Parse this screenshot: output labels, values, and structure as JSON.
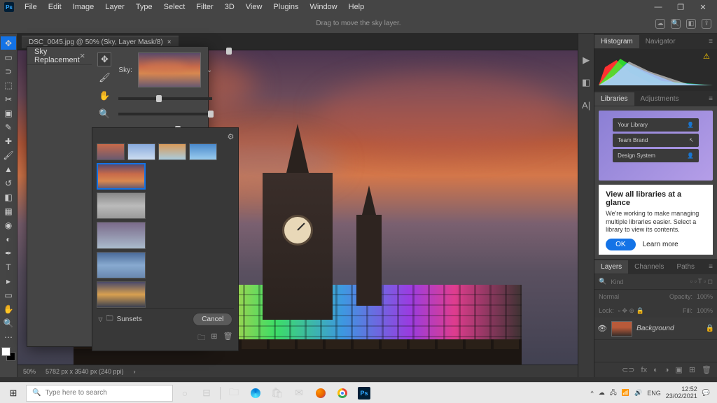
{
  "menubar": {
    "items": [
      "File",
      "Edit",
      "Image",
      "Layer",
      "Type",
      "Select",
      "Filter",
      "3D",
      "View",
      "Plugins",
      "Window",
      "Help"
    ]
  },
  "options_hint": "Drag to move the sky layer.",
  "doc_tab": "DSC_0045.jpg @ 50% (Sky, Layer Mask/8)",
  "status": {
    "zoom": "50%",
    "dims": "5782 px x 3540 px (240 ppi)"
  },
  "dialog": {
    "title": "Sky Replacement",
    "sky_label": "Sky:",
    "preset_group": "Sunsets",
    "cancel": "Cancel"
  },
  "panels": {
    "histo_tabs": [
      "Histogram",
      "Navigator"
    ],
    "lib_tabs": [
      "Libraries",
      "Adjustments"
    ],
    "lib_cards": [
      "Your Library",
      "Team Brand",
      "Design System"
    ],
    "lib_heading": "View all libraries at a glance",
    "lib_body": "We're working to make managing multiple libraries easier. Select a library to view its contents.",
    "ok": "OK",
    "learn": "Learn more",
    "layer_tabs": [
      "Layers",
      "Channels",
      "Paths"
    ],
    "kind": "Kind",
    "blend": "Normal",
    "opacity_lbl": "Opacity:",
    "opacity_val": "100%",
    "lock_lbl": "Lock:",
    "fill_lbl": "Fill:",
    "fill_val": "100%",
    "bg_layer": "Background"
  },
  "taskbar": {
    "search_ph": "Type here to search",
    "lang": "ENG",
    "time": "12:52",
    "date": "23/02/2021"
  }
}
